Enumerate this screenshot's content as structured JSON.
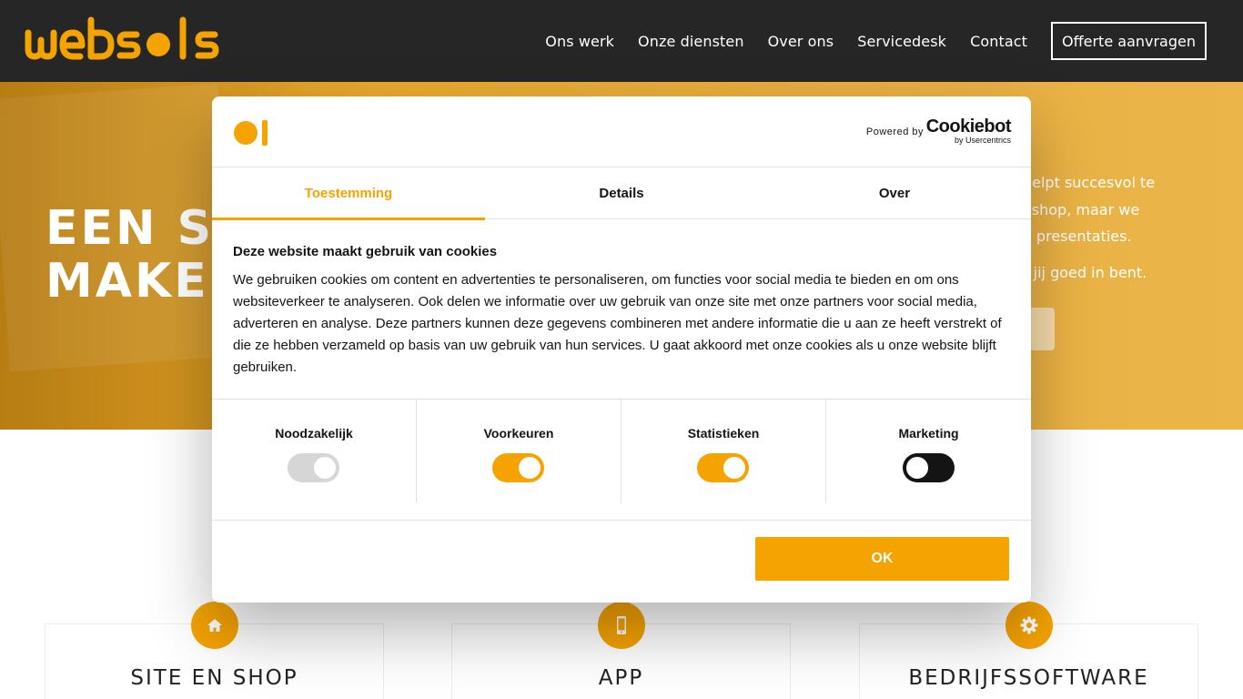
{
  "colors": {
    "header_bg": "#262626",
    "accent": "#f5a300",
    "hero": "#e9a92b",
    "text": "#141414"
  },
  "header": {
    "logo_text": "websols",
    "nav": [
      "Ons werk",
      "Onze diensten",
      "Over ons",
      "Servicedesk",
      "Contact"
    ],
    "cta": "Offerte aanvragen"
  },
  "hero": {
    "title_line1": "EEN SIT",
    "title_line2": "MAKEN",
    "text_lines": [
      "helpt succesvol te",
      "oshop, maar we",
      "e presentaties."
    ],
    "text2": "r jij goed in bent."
  },
  "cards": [
    {
      "title": "SITE EN SHOP",
      "icon": "home-icon"
    },
    {
      "title": "APP",
      "icon": "smartphone-icon"
    },
    {
      "title": "BEDRIJFSSOFTWARE",
      "icon": "gear-icon"
    }
  ],
  "cookie_dialog": {
    "powered_by": "Powered by",
    "brand": "Cookiebot",
    "brand_sub": "by Usercentrics",
    "tabs": [
      "Toestemming",
      "Details",
      "Over"
    ],
    "active_tab": "Toestemming",
    "title": "Deze website maakt gebruik van cookies",
    "body": "We gebruiken cookies om content en advertenties te personaliseren, om functies voor social media te bieden en om ons websiteverkeer te analyseren. Ook delen we informatie over uw gebruik van onze site met onze partners voor social media, adverteren en analyse. Deze partners kunnen deze gegevens combineren met andere informatie die u aan ze heeft verstrekt of die ze hebben verzameld op basis van uw gebruik van hun services. U gaat akkoord met onze cookies als u onze website blijft gebruiken.",
    "consents": [
      {
        "label": "Noodzakelijk",
        "state": "disabled-on"
      },
      {
        "label": "Voorkeuren",
        "state": "on"
      },
      {
        "label": "Statistieken",
        "state": "on"
      },
      {
        "label": "Marketing",
        "state": "off"
      }
    ],
    "ok_label": "OK"
  }
}
